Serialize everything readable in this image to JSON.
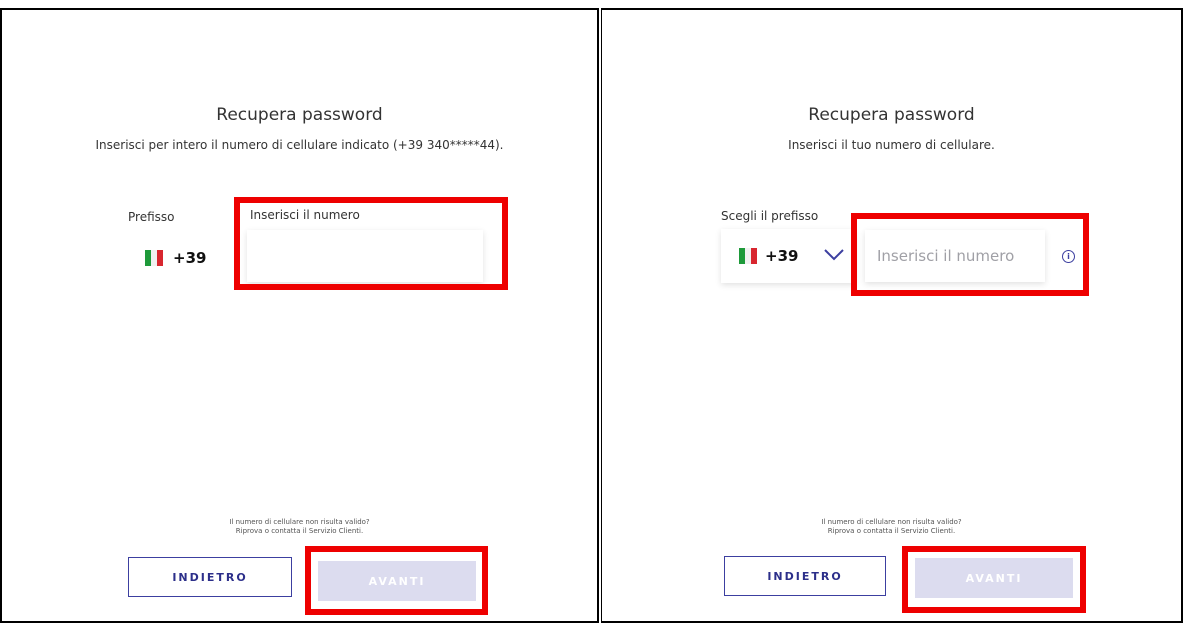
{
  "left": {
    "title": "Recupera password",
    "subtitle": "Inserisci per intero il numero di cellulare indicato (+39 340*****44).",
    "prefix_label": "Prefisso",
    "dial_code": "+39",
    "number_label": "Inserisci il numero",
    "number_value": "",
    "note_line1": "Il numero di cellulare non risulta valido?",
    "note_line2": "Riprova o contatta il Servizio Clienti.",
    "back_label": "INDIETRO",
    "next_label": "AVANTI"
  },
  "right": {
    "title": "Recupera password",
    "subtitle": "Inserisci il tuo numero di cellulare.",
    "prefix_label": "Scegli il prefisso",
    "dial_code": "+39",
    "number_placeholder": "Inserisci il numero",
    "note_line1": "Il numero di cellulare non risulta valido?",
    "note_line2": "Riprova o contatta il Servizio Clienti.",
    "back_label": "INDIETRO",
    "next_label": "AVANTI"
  },
  "colors": {
    "highlight": "#ee0000",
    "accent": "#3c3fa0",
    "disabled_button": "#dcdcef",
    "flag_green": "#1e9a3a",
    "flag_red": "#d8262f"
  },
  "icons": [
    "italy-flag-icon",
    "chevron-down-icon",
    "info-icon"
  ]
}
